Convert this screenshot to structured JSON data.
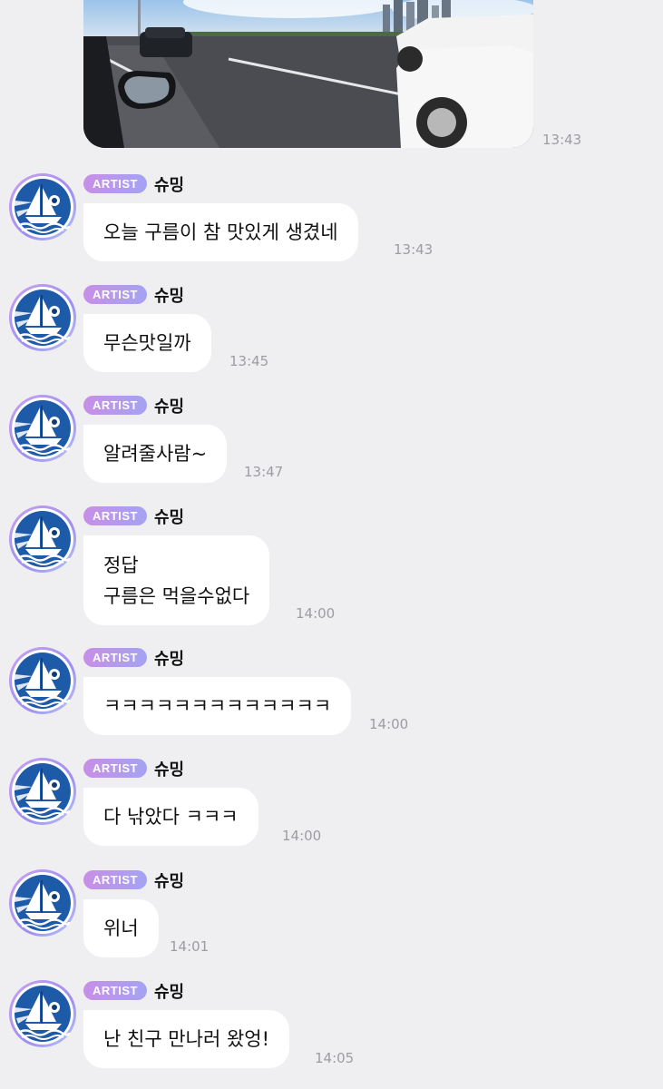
{
  "photo_message": {
    "time": "13:43"
  },
  "messages": [
    {
      "badge": "ARTIST",
      "sender": "슈밍",
      "lines": [
        "오늘 구름이 참 맛있게 생겼네"
      ],
      "time": "13:43"
    },
    {
      "badge": "ARTIST",
      "sender": "슈밍",
      "lines": [
        "무슨맛일까"
      ],
      "time": "13:45"
    },
    {
      "badge": "ARTIST",
      "sender": "슈밍",
      "lines": [
        "알려줄사람~"
      ],
      "time": "13:47"
    },
    {
      "badge": "ARTIST",
      "sender": "슈밍",
      "lines": [
        "정답",
        "구름은 먹을수없다"
      ],
      "time": "14:00"
    },
    {
      "badge": "ARTIST",
      "sender": "슈밍",
      "lines": [
        "ㅋㅋㅋㅋㅋㅋㅋㅋㅋㅋㅋㅋㅋ"
      ],
      "time": "14:00"
    },
    {
      "badge": "ARTIST",
      "sender": "슈밍",
      "lines": [
        "다 낚았다 ㅋㅋㅋ"
      ],
      "time": "14:00"
    },
    {
      "badge": "ARTIST",
      "sender": "슈밍",
      "lines": [
        "위너"
      ],
      "time": "14:01"
    },
    {
      "badge": "ARTIST",
      "sender": "슈밍",
      "lines": [
        "난 친구 만나러 왔엉!"
      ],
      "time": "14:05"
    }
  ],
  "colors": {
    "background": "#efeff1",
    "bubble": "#ffffff",
    "badge_gradient_start": "#c78fe6",
    "badge_gradient_end": "#a5a3f3",
    "time_text": "#9c9ca3",
    "avatar_blue": "#1d5aa8"
  }
}
